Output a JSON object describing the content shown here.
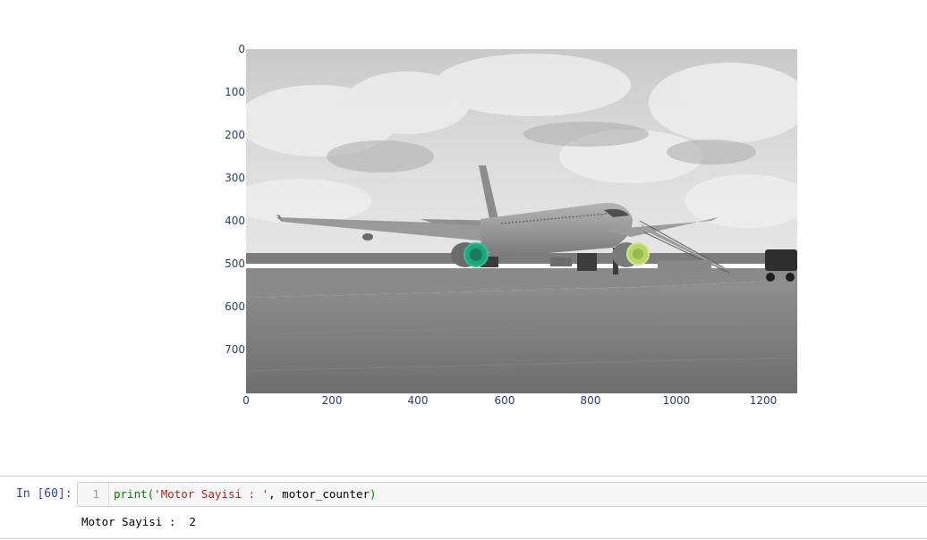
{
  "plot": {
    "y_ticks": [
      "0",
      "100",
      "200",
      "300",
      "400",
      "500",
      "600",
      "700"
    ],
    "x_ticks": [
      "0",
      "200",
      "400",
      "600",
      "800",
      "1000",
      "1200"
    ],
    "image_description": "grayscale airplane on tarmac with two engines highlighted",
    "highlight_colors": [
      "#1fa57c",
      "#b6d66a"
    ]
  },
  "cell": {
    "prompt": "In [60]:",
    "line_number": "1",
    "code": {
      "fn": "print",
      "open": "(",
      "str": "'Motor Sayisi : '",
      "sep": ", ",
      "var": "motor_counter",
      "close": ")"
    },
    "output": "Motor Sayisi :  2"
  },
  "colors": {
    "tick_text": "#2a3f5f",
    "prompt": "#303f9f",
    "keyword": "#008000",
    "string": "#ba2121"
  }
}
